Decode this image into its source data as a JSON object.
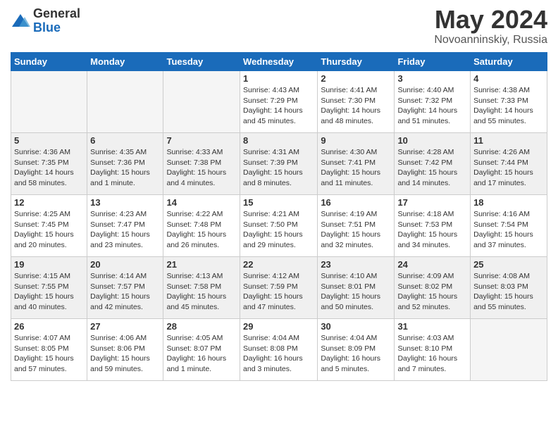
{
  "logo": {
    "general": "General",
    "blue": "Blue"
  },
  "title": "May 2024",
  "location": "Novoanninskiy, Russia",
  "days_of_week": [
    "Sunday",
    "Monday",
    "Tuesday",
    "Wednesday",
    "Thursday",
    "Friday",
    "Saturday"
  ],
  "weeks": [
    [
      {
        "day": "",
        "empty": true
      },
      {
        "day": "",
        "empty": true
      },
      {
        "day": "",
        "empty": true
      },
      {
        "day": "1",
        "sunrise": "Sunrise: 4:43 AM",
        "sunset": "Sunset: 7:29 PM",
        "daylight": "Daylight: 14 hours and 45 minutes."
      },
      {
        "day": "2",
        "sunrise": "Sunrise: 4:41 AM",
        "sunset": "Sunset: 7:30 PM",
        "daylight": "Daylight: 14 hours and 48 minutes."
      },
      {
        "day": "3",
        "sunrise": "Sunrise: 4:40 AM",
        "sunset": "Sunset: 7:32 PM",
        "daylight": "Daylight: 14 hours and 51 minutes."
      },
      {
        "day": "4",
        "sunrise": "Sunrise: 4:38 AM",
        "sunset": "Sunset: 7:33 PM",
        "daylight": "Daylight: 14 hours and 55 minutes."
      }
    ],
    [
      {
        "day": "5",
        "sunrise": "Sunrise: 4:36 AM",
        "sunset": "Sunset: 7:35 PM",
        "daylight": "Daylight: 14 hours and 58 minutes."
      },
      {
        "day": "6",
        "sunrise": "Sunrise: 4:35 AM",
        "sunset": "Sunset: 7:36 PM",
        "daylight": "Daylight: 15 hours and 1 minute."
      },
      {
        "day": "7",
        "sunrise": "Sunrise: 4:33 AM",
        "sunset": "Sunset: 7:38 PM",
        "daylight": "Daylight: 15 hours and 4 minutes."
      },
      {
        "day": "8",
        "sunrise": "Sunrise: 4:31 AM",
        "sunset": "Sunset: 7:39 PM",
        "daylight": "Daylight: 15 hours and 8 minutes."
      },
      {
        "day": "9",
        "sunrise": "Sunrise: 4:30 AM",
        "sunset": "Sunset: 7:41 PM",
        "daylight": "Daylight: 15 hours and 11 minutes."
      },
      {
        "day": "10",
        "sunrise": "Sunrise: 4:28 AM",
        "sunset": "Sunset: 7:42 PM",
        "daylight": "Daylight: 15 hours and 14 minutes."
      },
      {
        "day": "11",
        "sunrise": "Sunrise: 4:26 AM",
        "sunset": "Sunset: 7:44 PM",
        "daylight": "Daylight: 15 hours and 17 minutes."
      }
    ],
    [
      {
        "day": "12",
        "sunrise": "Sunrise: 4:25 AM",
        "sunset": "Sunset: 7:45 PM",
        "daylight": "Daylight: 15 hours and 20 minutes."
      },
      {
        "day": "13",
        "sunrise": "Sunrise: 4:23 AM",
        "sunset": "Sunset: 7:47 PM",
        "daylight": "Daylight: 15 hours and 23 minutes."
      },
      {
        "day": "14",
        "sunrise": "Sunrise: 4:22 AM",
        "sunset": "Sunset: 7:48 PM",
        "daylight": "Daylight: 15 hours and 26 minutes."
      },
      {
        "day": "15",
        "sunrise": "Sunrise: 4:21 AM",
        "sunset": "Sunset: 7:50 PM",
        "daylight": "Daylight: 15 hours and 29 minutes."
      },
      {
        "day": "16",
        "sunrise": "Sunrise: 4:19 AM",
        "sunset": "Sunset: 7:51 PM",
        "daylight": "Daylight: 15 hours and 32 minutes."
      },
      {
        "day": "17",
        "sunrise": "Sunrise: 4:18 AM",
        "sunset": "Sunset: 7:53 PM",
        "daylight": "Daylight: 15 hours and 34 minutes."
      },
      {
        "day": "18",
        "sunrise": "Sunrise: 4:16 AM",
        "sunset": "Sunset: 7:54 PM",
        "daylight": "Daylight: 15 hours and 37 minutes."
      }
    ],
    [
      {
        "day": "19",
        "sunrise": "Sunrise: 4:15 AM",
        "sunset": "Sunset: 7:55 PM",
        "daylight": "Daylight: 15 hours and 40 minutes."
      },
      {
        "day": "20",
        "sunrise": "Sunrise: 4:14 AM",
        "sunset": "Sunset: 7:57 PM",
        "daylight": "Daylight: 15 hours and 42 minutes."
      },
      {
        "day": "21",
        "sunrise": "Sunrise: 4:13 AM",
        "sunset": "Sunset: 7:58 PM",
        "daylight": "Daylight: 15 hours and 45 minutes."
      },
      {
        "day": "22",
        "sunrise": "Sunrise: 4:12 AM",
        "sunset": "Sunset: 7:59 PM",
        "daylight": "Daylight: 15 hours and 47 minutes."
      },
      {
        "day": "23",
        "sunrise": "Sunrise: 4:10 AM",
        "sunset": "Sunset: 8:01 PM",
        "daylight": "Daylight: 15 hours and 50 minutes."
      },
      {
        "day": "24",
        "sunrise": "Sunrise: 4:09 AM",
        "sunset": "Sunset: 8:02 PM",
        "daylight": "Daylight: 15 hours and 52 minutes."
      },
      {
        "day": "25",
        "sunrise": "Sunrise: 4:08 AM",
        "sunset": "Sunset: 8:03 PM",
        "daylight": "Daylight: 15 hours and 55 minutes."
      }
    ],
    [
      {
        "day": "26",
        "sunrise": "Sunrise: 4:07 AM",
        "sunset": "Sunset: 8:05 PM",
        "daylight": "Daylight: 15 hours and 57 minutes."
      },
      {
        "day": "27",
        "sunrise": "Sunrise: 4:06 AM",
        "sunset": "Sunset: 8:06 PM",
        "daylight": "Daylight: 15 hours and 59 minutes."
      },
      {
        "day": "28",
        "sunrise": "Sunrise: 4:05 AM",
        "sunset": "Sunset: 8:07 PM",
        "daylight": "Daylight: 16 hours and 1 minute."
      },
      {
        "day": "29",
        "sunrise": "Sunrise: 4:04 AM",
        "sunset": "Sunset: 8:08 PM",
        "daylight": "Daylight: 16 hours and 3 minutes."
      },
      {
        "day": "30",
        "sunrise": "Sunrise: 4:04 AM",
        "sunset": "Sunset: 8:09 PM",
        "daylight": "Daylight: 16 hours and 5 minutes."
      },
      {
        "day": "31",
        "sunrise": "Sunrise: 4:03 AM",
        "sunset": "Sunset: 8:10 PM",
        "daylight": "Daylight: 16 hours and 7 minutes."
      },
      {
        "day": "",
        "empty": true
      }
    ]
  ]
}
